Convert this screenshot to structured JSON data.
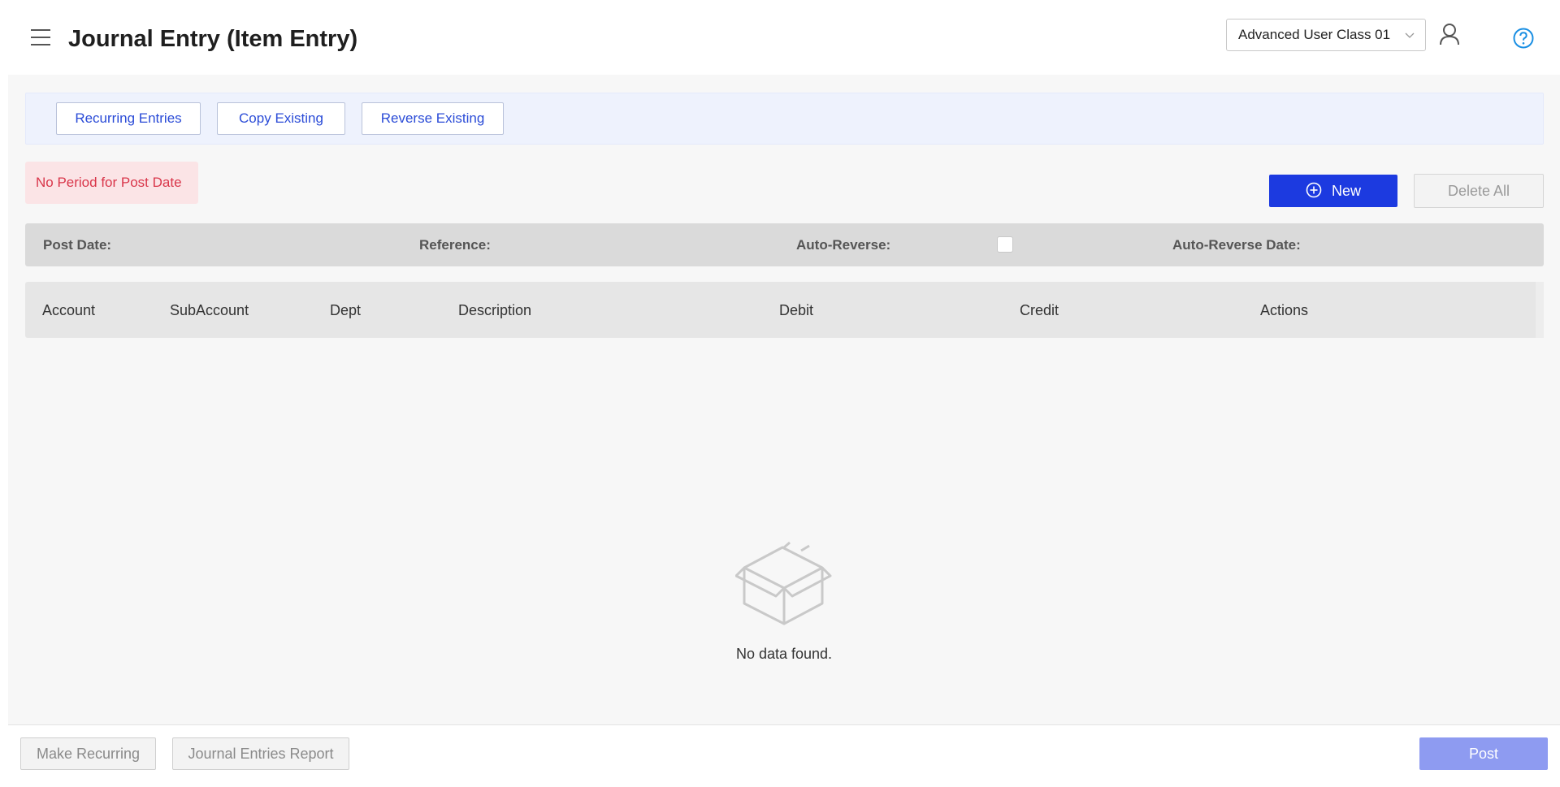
{
  "header": {
    "title": "Journal Entry (Item Entry)",
    "user_class": "Advanced User Class 01",
    "icons": {
      "menu": "hamburger-icon",
      "user": "user-icon",
      "help": "help-icon"
    }
  },
  "toolbar": {
    "recurring_label": "Recurring Entries",
    "copy_label": "Copy Existing",
    "reverse_label": "Reverse Existing"
  },
  "alert": {
    "message": "No Period for Post Date"
  },
  "actions": {
    "new_label": "New",
    "delete_all_label": "Delete All"
  },
  "entry_fields": {
    "post_date_label": "Post Date",
    "reference_label": "Reference",
    "auto_reverse_label": "Auto-Reverse",
    "auto_reverse_checked": false,
    "auto_reverse_date_label": "Auto-Reverse Date",
    "separator": ":"
  },
  "table": {
    "columns": [
      "Account",
      "SubAccount",
      "Dept",
      "Description",
      "Debit",
      "Credit",
      "Actions"
    ],
    "rows": [],
    "empty_message": "No data found."
  },
  "footer": {
    "make_recurring_label": "Make Recurring",
    "report_label": "Journal Entries Report",
    "post_label": "Post"
  },
  "colors": {
    "primary": "#1c3ae0",
    "primary_disabled": "#8e9bf1",
    "link_blue": "#2a4bd7",
    "error_text": "#d9364a",
    "error_bg": "#fbe4e6",
    "help_blue": "#1a8fe3"
  }
}
